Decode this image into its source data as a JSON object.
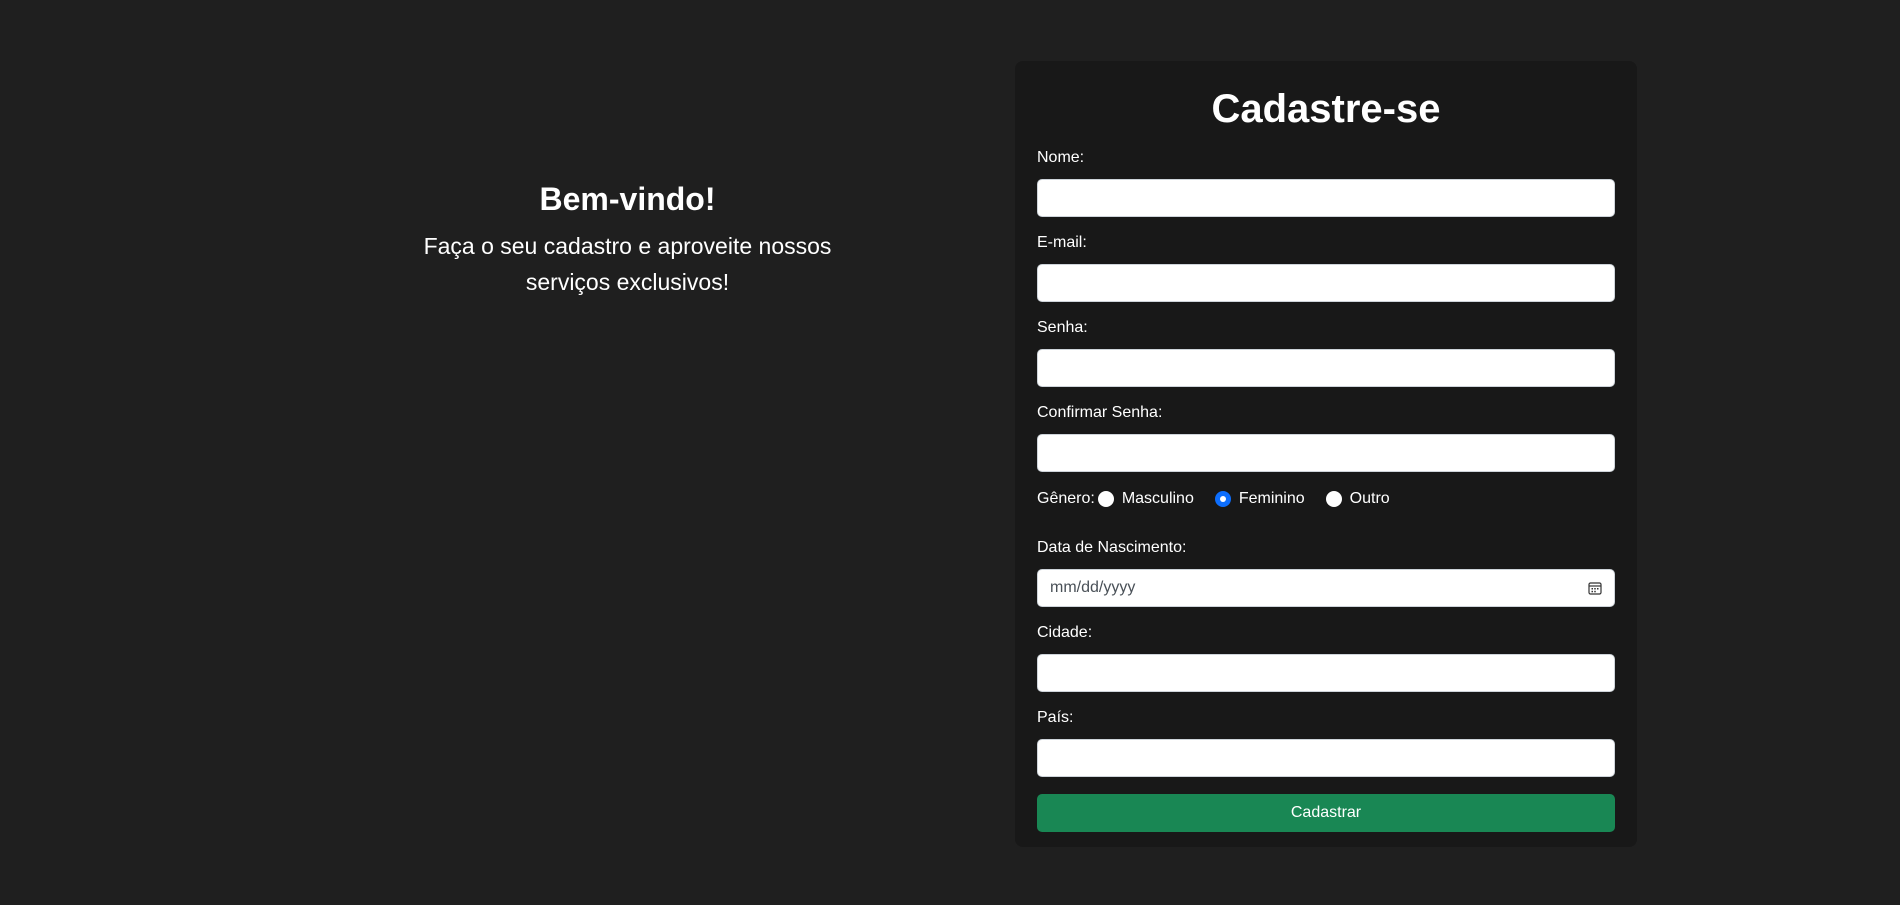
{
  "welcome": {
    "title": "Bem-vindo!",
    "line1": "Faça o seu cadastro e aproveite nossos",
    "line2": "serviços exclusivos!"
  },
  "form": {
    "title": "Cadastre-se",
    "fields": {
      "nome": {
        "label": "Nome:",
        "value": ""
      },
      "email": {
        "label": "E-mail:",
        "value": ""
      },
      "senha": {
        "label": "Senha:",
        "value": ""
      },
      "confirmar_senha": {
        "label": "Confirmar Senha:",
        "value": ""
      },
      "data_nascimento": {
        "label": "Data de Nascimento:",
        "placeholder": "mm/dd/yyyy"
      },
      "cidade": {
        "label": "Cidade:",
        "value": ""
      },
      "pais": {
        "label": "País:",
        "value": ""
      }
    },
    "genero": {
      "label": "Gênero:",
      "options": [
        "Masculino",
        "Feminino",
        "Outro"
      ],
      "selected": "Feminino"
    },
    "submit_label": "Cadastrar"
  },
  "colors": {
    "background": "#1f1f1f",
    "card": "#181818",
    "submit": "#198754",
    "radio_checked": "#0d6efd"
  },
  "icons": {
    "date": "calendar-icon"
  }
}
